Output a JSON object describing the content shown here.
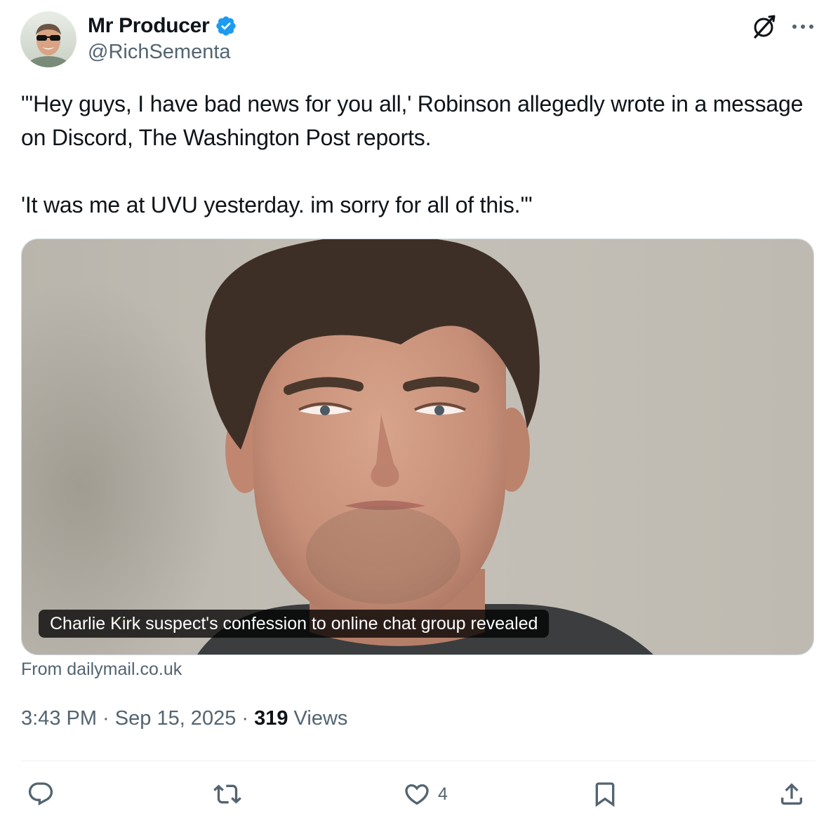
{
  "author": {
    "display_name": "Mr Producer",
    "handle": "@RichSementa",
    "verified": true,
    "verified_color": "#1d9bf0"
  },
  "header_icons": [
    "grok-icon",
    "more-options-icon"
  ],
  "tweet": {
    "text": "\"'Hey guys, I have bad news for you all,' Robinson allegedly wrote in a message on Discord, The Washington Post reports.\n\n'It was me at UVU yesterday. im sorry for all of this.'\""
  },
  "media": {
    "caption": "Charlie Kirk suspect's confession to online chat group revealed",
    "source": "From dailymail.co.uk"
  },
  "meta": {
    "time": "3:43 PM",
    "separator": " · ",
    "date": "Sep 15, 2025",
    "views_count": "319",
    "views_label": " Views"
  },
  "actions": {
    "reply": {
      "icon": "reply-icon",
      "count": ""
    },
    "retweet": {
      "icon": "retweet-icon",
      "count": ""
    },
    "like": {
      "icon": "heart-icon",
      "count": "4"
    },
    "bookmark": {
      "icon": "bookmark-icon",
      "count": ""
    },
    "share": {
      "icon": "share-icon",
      "count": ""
    }
  },
  "colors": {
    "text_primary": "#0f1419",
    "text_secondary": "#536471",
    "border": "#cfd9de"
  }
}
